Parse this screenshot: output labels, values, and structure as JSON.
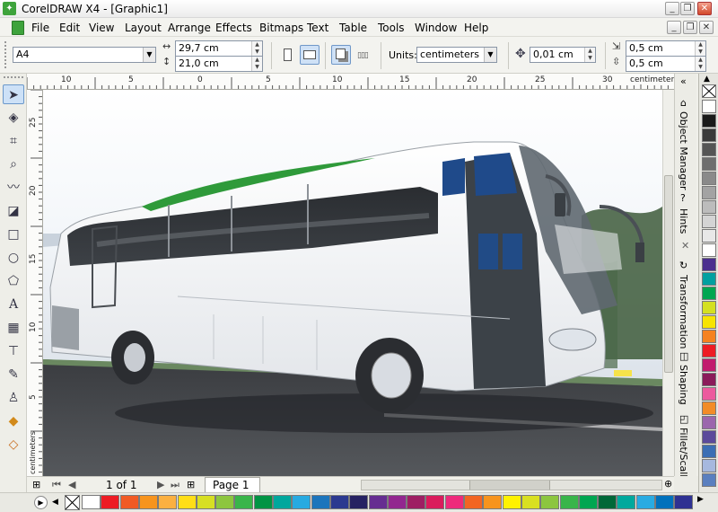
{
  "window": {
    "title": "CorelDRAW X4 - [Graphic1]",
    "app_icon": "corel-balloon-icon",
    "controls": [
      "minimize-icon",
      "restore-icon",
      "close-icon"
    ]
  },
  "menu": [
    "File",
    "Edit",
    "View",
    "Layout",
    "Arrange",
    "Effects",
    "Bitmaps",
    "Text",
    "Table",
    "Tools",
    "Window",
    "Help"
  ],
  "doc_controls": [
    "minimize-icon",
    "restore-icon",
    "close-icon"
  ],
  "property_bar": {
    "paper_size": "A4",
    "width": "29,7 cm",
    "height": "21,0 cm",
    "units_label": "Units:",
    "units": "centimeters",
    "nudge": "0,01 cm",
    "dup_x": "0,5 cm",
    "dup_y": "0,5 cm"
  },
  "tools": [
    "pick-tool-icon",
    "shape-tool-icon",
    "crop-tool-icon",
    "zoom-tool-icon",
    "freehand-tool-icon",
    "smart-fill-icon",
    "rectangle-tool-icon",
    "ellipse-tool-icon",
    "polygon-tool-icon",
    "text-tool-icon",
    "table-tool-icon",
    "interactive-blend-icon",
    "eyedropper-tool-icon",
    "outline-tool-icon",
    "fill-tool-icon",
    "interactive-fill-icon"
  ],
  "ruler": {
    "units": "centimeters",
    "h_labels": [
      "10",
      "5",
      "0",
      "5",
      "10",
      "15",
      "20",
      "25",
      "30"
    ],
    "h_unit": "centimeters",
    "v_labels": [
      "25",
      "20",
      "15",
      "10",
      "5"
    ],
    "v_unit": "centimeters"
  },
  "dockers": [
    "Object Manager",
    "Hints",
    "Transformation",
    "Shaping",
    "Fillet/Scallo..."
  ],
  "palette_vertical": [
    "#ffffff",
    "#1a1a1a",
    "#3a3a3a",
    "#555555",
    "#6e6e6e",
    "#8a8a8a",
    "#a3a3a3",
    "#bcbcbc",
    "#d4d4d4",
    "#e8e8e8",
    "#ffffff",
    "#4b2f8f",
    "#00a0a0",
    "#00a651",
    "#d4e021",
    "#f7e400",
    "#f58220",
    "#ed1c24",
    "#c11b6e",
    "#8b1b5a",
    "#ec5a9e",
    "#f28c28",
    "#9b66ad",
    "#5b4a9b",
    "#3b6eb4",
    "#a6b8de",
    "#5a7fbf"
  ],
  "page_nav": {
    "position": "1 of 1",
    "tab": "Page 1"
  },
  "palette_horizontal": [
    "#ffffff",
    "#ed1c24",
    "#f15a24",
    "#f7941d",
    "#fbb040",
    "#ffde17",
    "#d7df23",
    "#8dc63f",
    "#39b54a",
    "#009444",
    "#00a79d",
    "#27aae1",
    "#1c75bc",
    "#2b3990",
    "#262262",
    "#662d91",
    "#92278f",
    "#9e1f63",
    "#da1c5c",
    "#ee2a7b",
    "#f26522",
    "#f7941d",
    "#fff200",
    "#d9e021",
    "#8cc63f",
    "#39b54a",
    "#00a651",
    "#006838",
    "#00a99d",
    "#29abe2",
    "#0071bc",
    "#2e3192"
  ],
  "status": {
    "arrow": "arrow-right-icon",
    "none_swatch": "no-color-swatch"
  }
}
